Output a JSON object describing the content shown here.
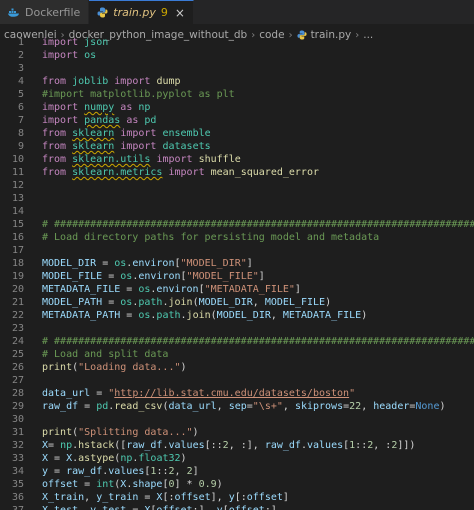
{
  "tabs": [
    {
      "label": "Dockerfile",
      "icon": "docker-icon",
      "active": false
    },
    {
      "label": "train.py",
      "icon": "python-icon",
      "active": true,
      "problems": "9",
      "close": "×"
    }
  ],
  "breadcrumb": [
    "caowenlei",
    "docker_python_image_without_db",
    "code",
    "train.py",
    "..."
  ],
  "breadcrumb_sep": "›",
  "colors": {
    "background": "#1e1e1e",
    "keyword": "#c586c0",
    "module": "#4ec9b0",
    "string": "#ce9178",
    "comment": "#6a9955",
    "function": "#dcdcaa",
    "variable": "#9cdcfe",
    "number": "#b5cea8"
  },
  "lines": [
    {
      "n": "1",
      "t": [
        [
          "kw",
          "import"
        ],
        [
          "op",
          " "
        ],
        [
          "mod",
          "json"
        ]
      ]
    },
    {
      "n": "2",
      "t": [
        [
          "kw",
          "import"
        ],
        [
          "op",
          " "
        ],
        [
          "mod",
          "os"
        ]
      ]
    },
    {
      "n": "3",
      "t": []
    },
    {
      "n": "4",
      "t": [
        [
          "kw",
          "from"
        ],
        [
          "op",
          " "
        ],
        [
          "mod",
          "joblib"
        ],
        [
          "op",
          " "
        ],
        [
          "kw",
          "import"
        ],
        [
          "op",
          " "
        ],
        [
          "fn",
          "dump"
        ]
      ]
    },
    {
      "n": "5",
      "t": [
        [
          "cm",
          "#import matplotlib.pyplot as plt"
        ]
      ]
    },
    {
      "n": "6",
      "t": [
        [
          "kw",
          "import"
        ],
        [
          "op",
          " "
        ],
        [
          "mod sq",
          "numpy"
        ],
        [
          "op",
          " "
        ],
        [
          "kw",
          "as"
        ],
        [
          "op",
          " "
        ],
        [
          "mod",
          "np"
        ]
      ]
    },
    {
      "n": "7",
      "t": [
        [
          "kw",
          "import"
        ],
        [
          "op",
          " "
        ],
        [
          "mod sq",
          "pandas"
        ],
        [
          "op",
          " "
        ],
        [
          "kw",
          "as"
        ],
        [
          "op",
          " "
        ],
        [
          "mod",
          "pd"
        ]
      ]
    },
    {
      "n": "8",
      "t": [
        [
          "kw",
          "from"
        ],
        [
          "op",
          " "
        ],
        [
          "mod sq",
          "sklearn"
        ],
        [
          "op",
          " "
        ],
        [
          "kw",
          "import"
        ],
        [
          "op",
          " "
        ],
        [
          "mod",
          "ensemble"
        ]
      ]
    },
    {
      "n": "9",
      "t": [
        [
          "kw",
          "from"
        ],
        [
          "op",
          " "
        ],
        [
          "mod sq",
          "sklearn"
        ],
        [
          "op",
          " "
        ],
        [
          "kw",
          "import"
        ],
        [
          "op",
          " "
        ],
        [
          "mod",
          "datasets"
        ]
      ]
    },
    {
      "n": "10",
      "t": [
        [
          "kw",
          "from"
        ],
        [
          "op",
          " "
        ],
        [
          "mod sq",
          "sklearn.utils"
        ],
        [
          "op",
          " "
        ],
        [
          "kw",
          "import"
        ],
        [
          "op",
          " "
        ],
        [
          "fn",
          "shuffle"
        ]
      ]
    },
    {
      "n": "11",
      "t": [
        [
          "kw",
          "from"
        ],
        [
          "op",
          " "
        ],
        [
          "mod sq",
          "sklearn.metrics"
        ],
        [
          "op",
          " "
        ],
        [
          "kw",
          "import"
        ],
        [
          "op",
          " "
        ],
        [
          "fn",
          "mean_squared_error"
        ]
      ]
    },
    {
      "n": "12",
      "t": []
    },
    {
      "n": "13",
      "t": []
    },
    {
      "n": "14",
      "t": []
    },
    {
      "n": "15",
      "t": [
        [
          "cm",
          "# ##############################################################################"
        ]
      ]
    },
    {
      "n": "16",
      "t": [
        [
          "cm",
          "# Load directory paths for persisting model and metadata"
        ]
      ]
    },
    {
      "n": "17",
      "t": []
    },
    {
      "n": "18",
      "t": [
        [
          "var",
          "MODEL_DIR"
        ],
        [
          "op",
          " = "
        ],
        [
          "mod",
          "os"
        ],
        [
          "op",
          "."
        ],
        [
          "var",
          "environ"
        ],
        [
          "op",
          "["
        ],
        [
          "str",
          "\"MODEL_DIR\""
        ],
        [
          "op",
          "]"
        ]
      ]
    },
    {
      "n": "19",
      "t": [
        [
          "var",
          "MODEL_FILE"
        ],
        [
          "op",
          " = "
        ],
        [
          "mod",
          "os"
        ],
        [
          "op",
          "."
        ],
        [
          "var",
          "environ"
        ],
        [
          "op",
          "["
        ],
        [
          "str",
          "\"MODEL_FILE\""
        ],
        [
          "op",
          "]"
        ]
      ]
    },
    {
      "n": "20",
      "t": [
        [
          "var",
          "METADATA_FILE"
        ],
        [
          "op",
          " = "
        ],
        [
          "mod",
          "os"
        ],
        [
          "op",
          "."
        ],
        [
          "var",
          "environ"
        ],
        [
          "op",
          "["
        ],
        [
          "str",
          "\"METADATA_FILE\""
        ],
        [
          "op",
          "]"
        ]
      ]
    },
    {
      "n": "21",
      "t": [
        [
          "var",
          "MODEL_PATH"
        ],
        [
          "op",
          " = "
        ],
        [
          "mod",
          "os"
        ],
        [
          "op",
          "."
        ],
        [
          "mod",
          "path"
        ],
        [
          "op",
          "."
        ],
        [
          "fn",
          "join"
        ],
        [
          "op",
          "("
        ],
        [
          "var",
          "MODEL_DIR"
        ],
        [
          "op",
          ", "
        ],
        [
          "var",
          "MODEL_FILE"
        ],
        [
          "op",
          ")"
        ]
      ]
    },
    {
      "n": "22",
      "t": [
        [
          "var",
          "METADATA_PATH"
        ],
        [
          "op",
          " = "
        ],
        [
          "mod",
          "os"
        ],
        [
          "op",
          "."
        ],
        [
          "mod",
          "path"
        ],
        [
          "op",
          "."
        ],
        [
          "fn",
          "join"
        ],
        [
          "op",
          "("
        ],
        [
          "var",
          "MODEL_DIR"
        ],
        [
          "op",
          ", "
        ],
        [
          "var",
          "METADATA_FILE"
        ],
        [
          "op",
          ")"
        ]
      ]
    },
    {
      "n": "23",
      "t": []
    },
    {
      "n": "24",
      "t": [
        [
          "cm",
          "# ##############################################################################"
        ]
      ]
    },
    {
      "n": "25",
      "t": [
        [
          "cm",
          "# Load and split data"
        ]
      ]
    },
    {
      "n": "26",
      "t": [
        [
          "fn",
          "print"
        ],
        [
          "op",
          "("
        ],
        [
          "str",
          "\"Loading data...\""
        ],
        [
          "op",
          ")"
        ]
      ]
    },
    {
      "n": "27",
      "t": []
    },
    {
      "n": "28",
      "t": [
        [
          "var",
          "data_url"
        ],
        [
          "op",
          " = "
        ],
        [
          "str",
          "\""
        ],
        [
          "url",
          "http://lib.stat.cmu.edu/datasets/boston"
        ],
        [
          "str",
          "\""
        ]
      ]
    },
    {
      "n": "29",
      "t": [
        [
          "var",
          "raw_df"
        ],
        [
          "op",
          " = "
        ],
        [
          "mod",
          "pd"
        ],
        [
          "op",
          "."
        ],
        [
          "fn",
          "read_csv"
        ],
        [
          "op",
          "("
        ],
        [
          "var",
          "data_url"
        ],
        [
          "op",
          ", "
        ],
        [
          "var",
          "sep"
        ],
        [
          "op",
          "="
        ],
        [
          "str",
          "\"\\s+\""
        ],
        [
          "op",
          ", "
        ],
        [
          "var",
          "skiprows"
        ],
        [
          "op",
          "="
        ],
        [
          "num",
          "22"
        ],
        [
          "op",
          ", "
        ],
        [
          "var",
          "header"
        ],
        [
          "op",
          "="
        ],
        [
          "bi",
          "None"
        ],
        [
          "op",
          ")"
        ]
      ]
    },
    {
      "n": "30",
      "t": []
    },
    {
      "n": "31",
      "t": [
        [
          "fn",
          "print"
        ],
        [
          "op",
          "("
        ],
        [
          "str",
          "\"Splitting data...\""
        ],
        [
          "op",
          ")"
        ]
      ]
    },
    {
      "n": "32",
      "t": [
        [
          "var",
          "X"
        ],
        [
          "op",
          "= "
        ],
        [
          "mod",
          "np"
        ],
        [
          "op",
          "."
        ],
        [
          "fn",
          "hstack"
        ],
        [
          "op",
          "(["
        ],
        [
          "var",
          "raw_df"
        ],
        [
          "op",
          "."
        ],
        [
          "var",
          "values"
        ],
        [
          "op",
          "[::"
        ],
        [
          "num",
          "2"
        ],
        [
          "op",
          ", :], "
        ],
        [
          "var",
          "raw_df"
        ],
        [
          "op",
          "."
        ],
        [
          "var",
          "values"
        ],
        [
          "op",
          "["
        ],
        [
          "num",
          "1"
        ],
        [
          "op",
          "::"
        ],
        [
          "num",
          "2"
        ],
        [
          "op",
          ", :"
        ],
        [
          "num",
          "2"
        ],
        [
          "op",
          "]])"
        ]
      ]
    },
    {
      "n": "33",
      "t": [
        [
          "var",
          "X"
        ],
        [
          "op",
          " = "
        ],
        [
          "var",
          "X"
        ],
        [
          "op",
          "."
        ],
        [
          "fn",
          "astype"
        ],
        [
          "op",
          "("
        ],
        [
          "mod",
          "np"
        ],
        [
          "op",
          "."
        ],
        [
          "mod",
          "float32"
        ],
        [
          "op",
          ")"
        ]
      ]
    },
    {
      "n": "34",
      "t": [
        [
          "var",
          "y"
        ],
        [
          "op",
          " = "
        ],
        [
          "var",
          "raw_df"
        ],
        [
          "op",
          "."
        ],
        [
          "var",
          "values"
        ],
        [
          "op",
          "["
        ],
        [
          "num",
          "1"
        ],
        [
          "op",
          "::"
        ],
        [
          "num",
          "2"
        ],
        [
          "op",
          ", "
        ],
        [
          "num",
          "2"
        ],
        [
          "op",
          "]"
        ]
      ]
    },
    {
      "n": "35",
      "t": [
        [
          "var",
          "offset"
        ],
        [
          "op",
          " = "
        ],
        [
          "mod",
          "int"
        ],
        [
          "op",
          "("
        ],
        [
          "var",
          "X"
        ],
        [
          "op",
          "."
        ],
        [
          "var",
          "shape"
        ],
        [
          "op",
          "["
        ],
        [
          "num",
          "0"
        ],
        [
          "op",
          "] * "
        ],
        [
          "num",
          "0.9"
        ],
        [
          "op",
          ")"
        ]
      ]
    },
    {
      "n": "36",
      "t": [
        [
          "var",
          "X_train"
        ],
        [
          "op",
          ", "
        ],
        [
          "var",
          "y_train"
        ],
        [
          "op",
          " = "
        ],
        [
          "var",
          "X"
        ],
        [
          "op",
          "[:"
        ],
        [
          "var",
          "offset"
        ],
        [
          "op",
          "], "
        ],
        [
          "var",
          "y"
        ],
        [
          "op",
          "[:"
        ],
        [
          "var",
          "offset"
        ],
        [
          "op",
          "]"
        ]
      ]
    },
    {
      "n": "37",
      "t": [
        [
          "var",
          "X_test"
        ],
        [
          "op",
          ", "
        ],
        [
          "var",
          "y_test"
        ],
        [
          "op",
          " = "
        ],
        [
          "var",
          "X"
        ],
        [
          "op",
          "["
        ],
        [
          "var",
          "offset"
        ],
        [
          "op",
          ":], "
        ],
        [
          "var",
          "y"
        ],
        [
          "op",
          "["
        ],
        [
          "var",
          "offset"
        ],
        [
          "op",
          ":]"
        ]
      ]
    }
  ]
}
